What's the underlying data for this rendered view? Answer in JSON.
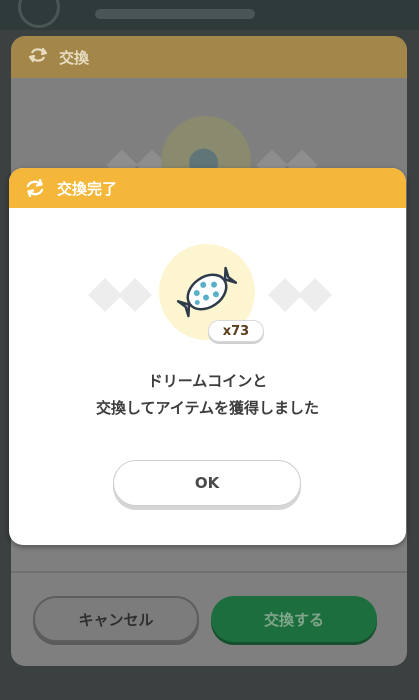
{
  "background_panel": {
    "title": "交換",
    "icon": "sync-icon",
    "buttons": {
      "cancel_label": "キャンセル",
      "exchange_label": "交換する"
    }
  },
  "dialog": {
    "title": "交換完了",
    "title_icon": "sync-icon",
    "item": {
      "icon": "candy-icon",
      "quantity": "x73"
    },
    "message_line1": "ドリームコインと",
    "message_line2": "交換してアイテムを獲得しました",
    "ok_label": "OK"
  },
  "colors": {
    "header_accent": "#f4b73a",
    "candy_blue": "#5ab0c8",
    "item_glow": "#fdf5cf",
    "exchange_green": "#1d6e3e"
  }
}
